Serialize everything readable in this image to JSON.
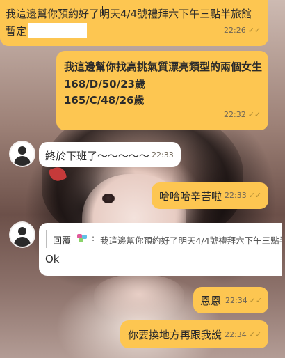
{
  "messages": [
    {
      "id": "m1",
      "text_line1": "我這邊幫你預約好了明天4/4號禮拜六下午三點半旅館",
      "text_line2": "暫定",
      "time": "22:26",
      "status": "✓✓"
    },
    {
      "id": "m2",
      "line1": "我這邊幫你找高挑氣質漂亮類型的兩個女生",
      "line2": "168/D/50/23歲",
      "line3": "165/C/48/26歲",
      "time": "22:32",
      "status": "✓✓"
    },
    {
      "id": "m3",
      "text": "終於下班了～～～～～",
      "time": "22:33"
    },
    {
      "id": "m4",
      "text": "哈哈哈辛苦啦",
      "time": "22:33",
      "status": "✓✓"
    },
    {
      "id": "m5",
      "reply_label": "回覆",
      "reply_text": "我這邊幫你預約好了明天4/4號禮拜六下午三點半旅",
      "text": "Ok"
    },
    {
      "id": "m6",
      "text": "恩恩",
      "time": "22:34",
      "status": "✓✓"
    },
    {
      "id": "m7",
      "text": "你要換地方再跟我說",
      "time": "22:34",
      "status": "✓✓"
    }
  ],
  "colors": {
    "outgoing": "#fdc651",
    "incoming": "#ffffff",
    "check": "#b08b33"
  },
  "icons": {
    "avatar": "default-user-avatar-icon",
    "read": "double-check-icon"
  }
}
